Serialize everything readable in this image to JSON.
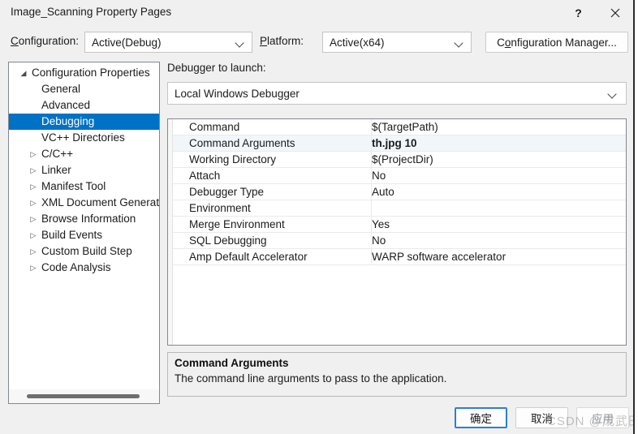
{
  "window": {
    "title": "Image_Scanning Property Pages",
    "help_icon": "question-mark-icon",
    "close_icon": "close-icon"
  },
  "config_bar": {
    "configuration_label": "Configuration:",
    "configuration_mnemonic": "C",
    "configuration_value": "Active(Debug)",
    "platform_label": "Platform:",
    "platform_mnemonic": "P",
    "platform_value": "Active(x64)",
    "config_manager_label": "Configuration Manager...",
    "config_manager_mnemonic": "o",
    "chevron_icon": "chevron-down-icon"
  },
  "tree": {
    "items": [
      {
        "label": "Configuration Properties",
        "level": 1,
        "arrow": "expanded",
        "selected": false
      },
      {
        "label": "General",
        "level": 2,
        "arrow": "none",
        "selected": false
      },
      {
        "label": "Advanced",
        "level": 2,
        "arrow": "none",
        "selected": false
      },
      {
        "label": "Debugging",
        "level": 2,
        "arrow": "none",
        "selected": true
      },
      {
        "label": "VC++ Directories",
        "level": 2,
        "arrow": "none",
        "selected": false
      },
      {
        "label": "C/C++",
        "level": 2,
        "arrow": "collapsed",
        "selected": false
      },
      {
        "label": "Linker",
        "level": 2,
        "arrow": "collapsed",
        "selected": false
      },
      {
        "label": "Manifest Tool",
        "level": 2,
        "arrow": "collapsed",
        "selected": false
      },
      {
        "label": "XML Document Generat",
        "level": 2,
        "arrow": "collapsed",
        "selected": false
      },
      {
        "label": "Browse Information",
        "level": 2,
        "arrow": "collapsed",
        "selected": false
      },
      {
        "label": "Build Events",
        "level": 2,
        "arrow": "collapsed",
        "selected": false
      },
      {
        "label": "Custom Build Step",
        "level": 2,
        "arrow": "collapsed",
        "selected": false
      },
      {
        "label": "Code Analysis",
        "level": 2,
        "arrow": "collapsed",
        "selected": false
      }
    ],
    "expanded_glyph": "◢",
    "collapsed_glyph": "▷",
    "scrollbar": "horizontal-scrollbar"
  },
  "main": {
    "debugger_label": "Debugger to launch:",
    "debugger_value": "Local Windows Debugger",
    "properties": [
      {
        "name": "Command",
        "value": "$(TargetPath)",
        "selected": false
      },
      {
        "name": "Command Arguments",
        "value": "th.jpg 10",
        "selected": true
      },
      {
        "name": "Working Directory",
        "value": "$(ProjectDir)",
        "selected": false
      },
      {
        "name": "Attach",
        "value": "No",
        "selected": false
      },
      {
        "name": "Debugger Type",
        "value": "Auto",
        "selected": false
      },
      {
        "name": "Environment",
        "value": "",
        "selected": false
      },
      {
        "name": "Merge Environment",
        "value": "Yes",
        "selected": false
      },
      {
        "name": "SQL Debugging",
        "value": "No",
        "selected": false
      },
      {
        "name": "Amp Default Accelerator",
        "value": "WARP software accelerator",
        "selected": false
      }
    ],
    "description": {
      "title": "Command Arguments",
      "text": "The command line arguments to pass to the application."
    }
  },
  "buttons": {
    "ok": "确定",
    "cancel": "取消",
    "apply": "应用"
  },
  "watermark": {
    "text": "CSDN @成武田"
  },
  "colors": {
    "selection_blue": "#0072c6",
    "focus_blue": "#2a7fd4",
    "dialog_bg": "#f0f0f0",
    "row_highlight": "#f1f6fb"
  }
}
